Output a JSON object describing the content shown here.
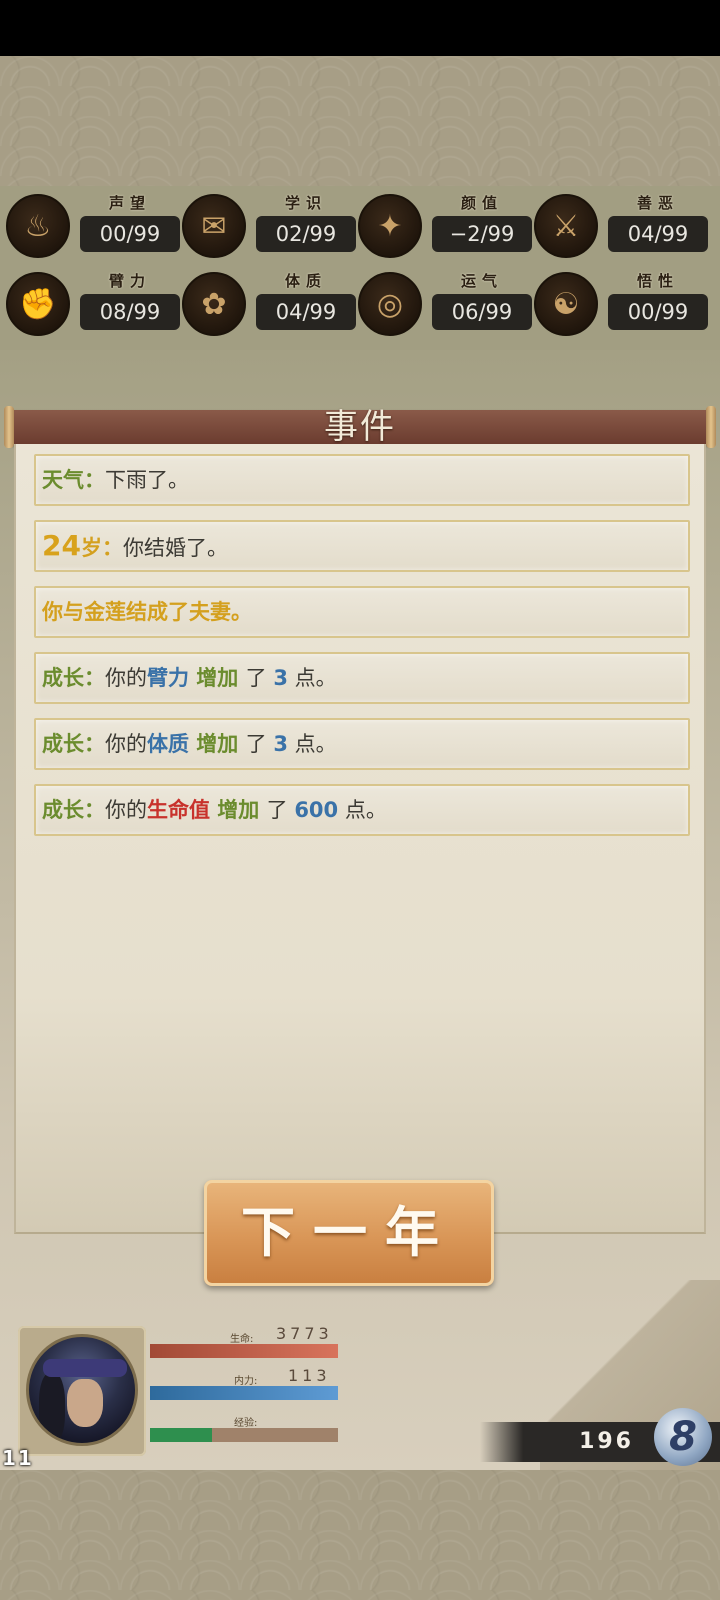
{
  "stats": [
    {
      "label": "声望",
      "value": "00/99",
      "icon": "bell-icon"
    },
    {
      "label": "学识",
      "value": "02/99",
      "icon": "scroll-icon"
    },
    {
      "label": "颜值",
      "value": "−2/99",
      "icon": "fan-icon"
    },
    {
      "label": "善恶",
      "value": "04/99",
      "icon": "crossed-swords-icon"
    },
    {
      "label": "臂力",
      "value": "08/99",
      "icon": "fist-icon"
    },
    {
      "label": "体质",
      "value": "04/99",
      "icon": "lotus-icon"
    },
    {
      "label": "运气",
      "value": "06/99",
      "icon": "coin-purse-icon"
    },
    {
      "label": "悟性",
      "value": "00/99",
      "icon": "mind-icon"
    }
  ],
  "panel": {
    "title": "事件"
  },
  "events": [
    {
      "parts": [
        {
          "text": "天气",
          "style": "g"
        },
        {
          "text": "：",
          "style": "g"
        },
        {
          "text": "下雨了。",
          "style": "gy"
        }
      ]
    },
    {
      "parts": [
        {
          "text": "24",
          "style": "ybig"
        },
        {
          "text": "岁",
          "style": "y"
        },
        {
          "text": "：",
          "style": "y"
        },
        {
          "text": "你结婚了。",
          "style": "gy"
        }
      ]
    },
    {
      "parts": [
        {
          "text": " 你与金莲结成了夫妻。",
          "style": "y"
        }
      ]
    },
    {
      "parts": [
        {
          "text": "成长",
          "style": "g"
        },
        {
          "text": "：",
          "style": "g"
        },
        {
          "text": "你的",
          "style": "gy"
        },
        {
          "text": "臂力",
          "style": "bl"
        },
        {
          "text": " 增加 ",
          "style": "g"
        },
        {
          "text": " 了 ",
          "style": "gy"
        },
        {
          "text": "3",
          "style": "bl"
        },
        {
          "text": " 点。",
          "style": "gy"
        }
      ]
    },
    {
      "parts": [
        {
          "text": "成长",
          "style": "g"
        },
        {
          "text": "：",
          "style": "g"
        },
        {
          "text": "你的",
          "style": "gy"
        },
        {
          "text": "体质",
          "style": "bl"
        },
        {
          "text": " 增加 ",
          "style": "g"
        },
        {
          "text": " 了 ",
          "style": "gy"
        },
        {
          "text": "3",
          "style": "bl"
        },
        {
          "text": " 点。",
          "style": "gy"
        }
      ]
    },
    {
      "parts": [
        {
          "text": "成长",
          "style": "g"
        },
        {
          "text": "：",
          "style": "g"
        },
        {
          "text": "你的",
          "style": "gy"
        },
        {
          "text": "生命值",
          "style": "r"
        },
        {
          "text": " 增加 ",
          "style": "g"
        },
        {
          "text": " 了 ",
          "style": "gy"
        },
        {
          "text": "600",
          "style": "bl"
        },
        {
          "text": " 点。",
          "style": "gy"
        }
      ]
    }
  ],
  "next_button": {
    "label": "下一年"
  },
  "player": {
    "level": "11",
    "hp_label": "生命:",
    "hp_value": "3773",
    "mp_label": "内力:",
    "mp_value": "113",
    "xp_label": "经验:",
    "xp_fraction": 0.33
  },
  "currency": {
    "value": "196",
    "symbol": "8"
  },
  "colors": {
    "accent": "#d99657",
    "panel_header": "#7a4a3b",
    "hp": "#d8735c",
    "mp": "#5e9bd4",
    "xp": "#2e8f4e"
  }
}
